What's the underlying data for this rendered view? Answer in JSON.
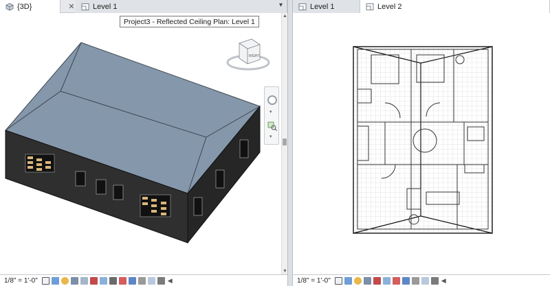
{
  "left_pane": {
    "tabs": [
      {
        "label": "{3D}"
      },
      {
        "label": "Level 1"
      }
    ],
    "tooltip": "Project3 - Reflected Ceiling Plan: Level 1",
    "view_cube": {
      "face_label": "RIGHT"
    },
    "scale": "1/8\" = 1'-0\""
  },
  "right_pane": {
    "tabs": [
      {
        "label": "Level 1"
      },
      {
        "label": "Level 2"
      }
    ],
    "scale": "1/8\" = 1'-0\""
  },
  "colors": {
    "roof": "#8a9cb0",
    "walls": "#2b2b2b",
    "window_frame": "#d8b87a",
    "plan_lines": "#333333"
  }
}
